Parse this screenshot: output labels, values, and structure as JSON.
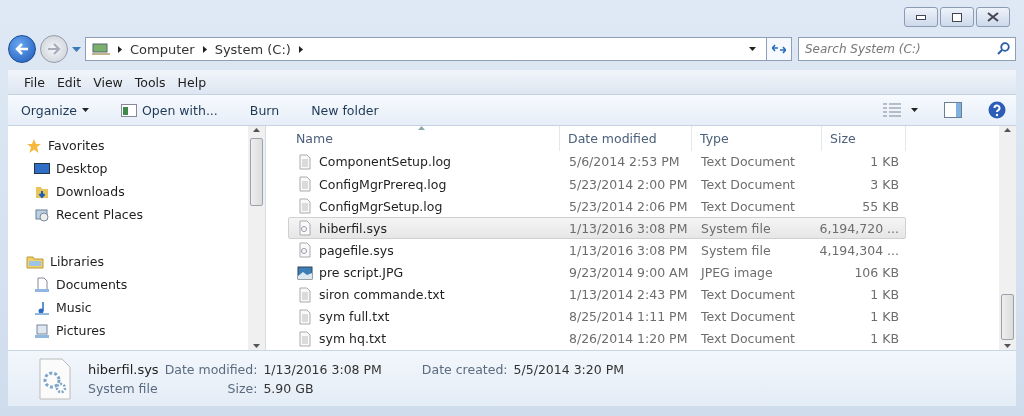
{
  "address": {
    "crumbs": [
      "Computer",
      "System (C:)"
    ]
  },
  "search": {
    "placeholder": "Search System (C:)"
  },
  "menu": [
    "File",
    "Edit",
    "View",
    "Tools",
    "Help"
  ],
  "toolbar": [
    {
      "label": "Organize",
      "kind": "dropdown"
    },
    {
      "label": "Open with...",
      "kind": "icon"
    },
    {
      "label": "Burn",
      "kind": "plain"
    },
    {
      "label": "New folder",
      "kind": "plain"
    }
  ],
  "sidebar": [
    {
      "label": "Favorites",
      "kind": "star",
      "children": [
        {
          "label": "Desktop",
          "kind": "desktop"
        },
        {
          "label": "Downloads",
          "kind": "download"
        },
        {
          "label": "Recent Places",
          "kind": "recent"
        }
      ]
    },
    {
      "label": "Libraries",
      "kind": "library",
      "children": [
        {
          "label": "Documents",
          "kind": "doc"
        },
        {
          "label": "Music",
          "kind": "music"
        },
        {
          "label": "Pictures",
          "kind": "picture"
        }
      ]
    }
  ],
  "table": {
    "columns": [
      "Name",
      "Date modified",
      "Type",
      "Size"
    ],
    "rows": [
      {
        "name": "ComponentSetup.log",
        "date": "5/6/2014 2:53 PM",
        "type": "Text Document",
        "size": "1 KB",
        "kind": "text",
        "selected": false
      },
      {
        "name": "ConfigMgrPrereq.log",
        "date": "5/23/2014 2:00 PM",
        "type": "Text Document",
        "size": "3 KB",
        "kind": "text",
        "selected": false
      },
      {
        "name": "ConfigMgrSetup.log",
        "date": "5/23/2014 2:06 PM",
        "type": "Text Document",
        "size": "55 KB",
        "kind": "text",
        "selected": false
      },
      {
        "name": "hiberfil.sys",
        "date": "1/13/2016 3:08 PM",
        "type": "System file",
        "size": "6,194,720 ...",
        "kind": "system",
        "selected": true
      },
      {
        "name": "pagefile.sys",
        "date": "1/13/2016 3:08 PM",
        "type": "System file",
        "size": "4,194,304 ...",
        "kind": "system",
        "selected": false
      },
      {
        "name": "pre script.JPG",
        "date": "9/23/2014 9:00 AM",
        "type": "JPEG image",
        "size": "106 KB",
        "kind": "image",
        "selected": false
      },
      {
        "name": "siron commande.txt",
        "date": "1/13/2014 2:43 PM",
        "type": "Text Document",
        "size": "1 KB",
        "kind": "text",
        "selected": false
      },
      {
        "name": "sym full.txt",
        "date": "8/25/2014 1:11 PM",
        "type": "Text Document",
        "size": "1 KB",
        "kind": "text",
        "selected": false
      },
      {
        "name": "sym hq.txt",
        "date": "8/26/2014 1:20 PM",
        "type": "Text Document",
        "size": "1 KB",
        "kind": "text",
        "selected": false
      }
    ]
  },
  "details": {
    "name": "hiberfil.sys",
    "type": "System file",
    "fields": [
      {
        "label": "Date modified:",
        "value": "1/13/2016 3:08 PM"
      },
      {
        "label": "Date created:",
        "value": "5/5/2014 3:20 PM"
      },
      {
        "label": "Size:",
        "value": "5.90 GB"
      }
    ]
  }
}
